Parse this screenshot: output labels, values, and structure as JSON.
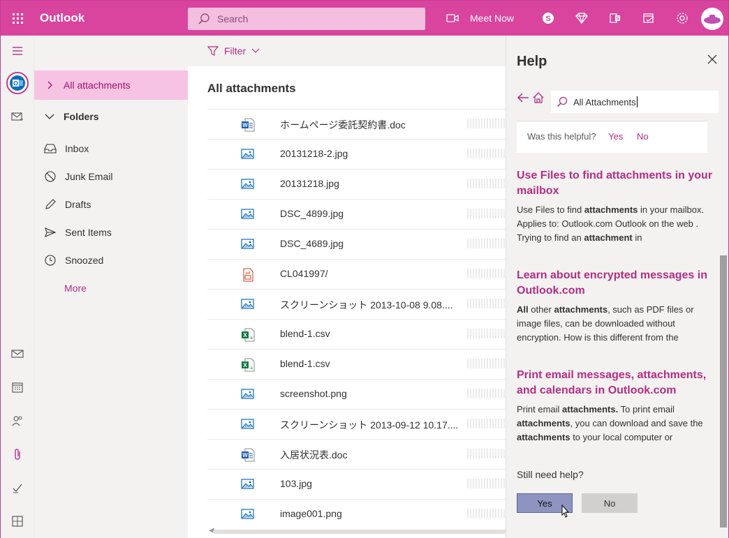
{
  "topbar": {
    "app_name": "Outlook",
    "search_placeholder": "Search",
    "meet_now": "Meet Now"
  },
  "folders": {
    "all_attachments": "All attachments",
    "folders_heading": "Folders",
    "inbox": "Inbox",
    "junk": "Junk Email",
    "drafts": "Drafts",
    "sent": "Sent Items",
    "snoozed": "Snoozed",
    "more": "More"
  },
  "main": {
    "filter_label": "Filter",
    "list_title": "All attachments",
    "files": [
      {
        "name": "ホームページ委託契約書.doc",
        "type": "word"
      },
      {
        "name": "20131218-2.jpg",
        "type": "image"
      },
      {
        "name": "20131218.jpg",
        "type": "image"
      },
      {
        "name": "DSC_4899.jpg",
        "type": "image"
      },
      {
        "name": "DSC_4689.jpg",
        "type": "image"
      },
      {
        "name": "CL041997/",
        "type": "pdf"
      },
      {
        "name": "スクリーンショット 2013-10-08 9.08....",
        "type": "image"
      },
      {
        "name": "blend-1.csv",
        "type": "excel"
      },
      {
        "name": "blend-1.csv",
        "type": "excel"
      },
      {
        "name": "screenshot.png",
        "type": "image"
      },
      {
        "name": "スクリーンショット 2013-09-12 10.17....",
        "type": "image"
      },
      {
        "name": "入居状況表.doc",
        "type": "word"
      },
      {
        "name": "103.jpg",
        "type": "image"
      },
      {
        "name": "image001.png",
        "type": "image"
      }
    ]
  },
  "help": {
    "title": "Help",
    "search_value": "All Attachments",
    "helpful_question": "Was this helpful?",
    "helpful_yes": "Yes",
    "helpful_no": "No",
    "articles": [
      {
        "title": "Use Files to find attachments in your mailbox",
        "body": "Use Files to find attachments in your mailbox. Applies to: Outlook.com Outlook on the web . Trying to find an attachment in"
      },
      {
        "title": "Learn about encrypted messages in Outlook.com",
        "body": "All other attachments, such as PDF files or image files, can be downloaded without encryption. How is this different from the"
      },
      {
        "title": "Print email messages, attachments, and calendars in Outlook.com",
        "body": "Print email attachments. To print email attachments, you can download and save the attachments to your local computer or"
      }
    ],
    "still_need_help": "Still need help?",
    "yes_button": "Yes",
    "no_button": "No"
  },
  "colors": {
    "brand": "#d9449e",
    "accent_text": "#b42d84",
    "selected_bg": "#f7c3e3"
  }
}
